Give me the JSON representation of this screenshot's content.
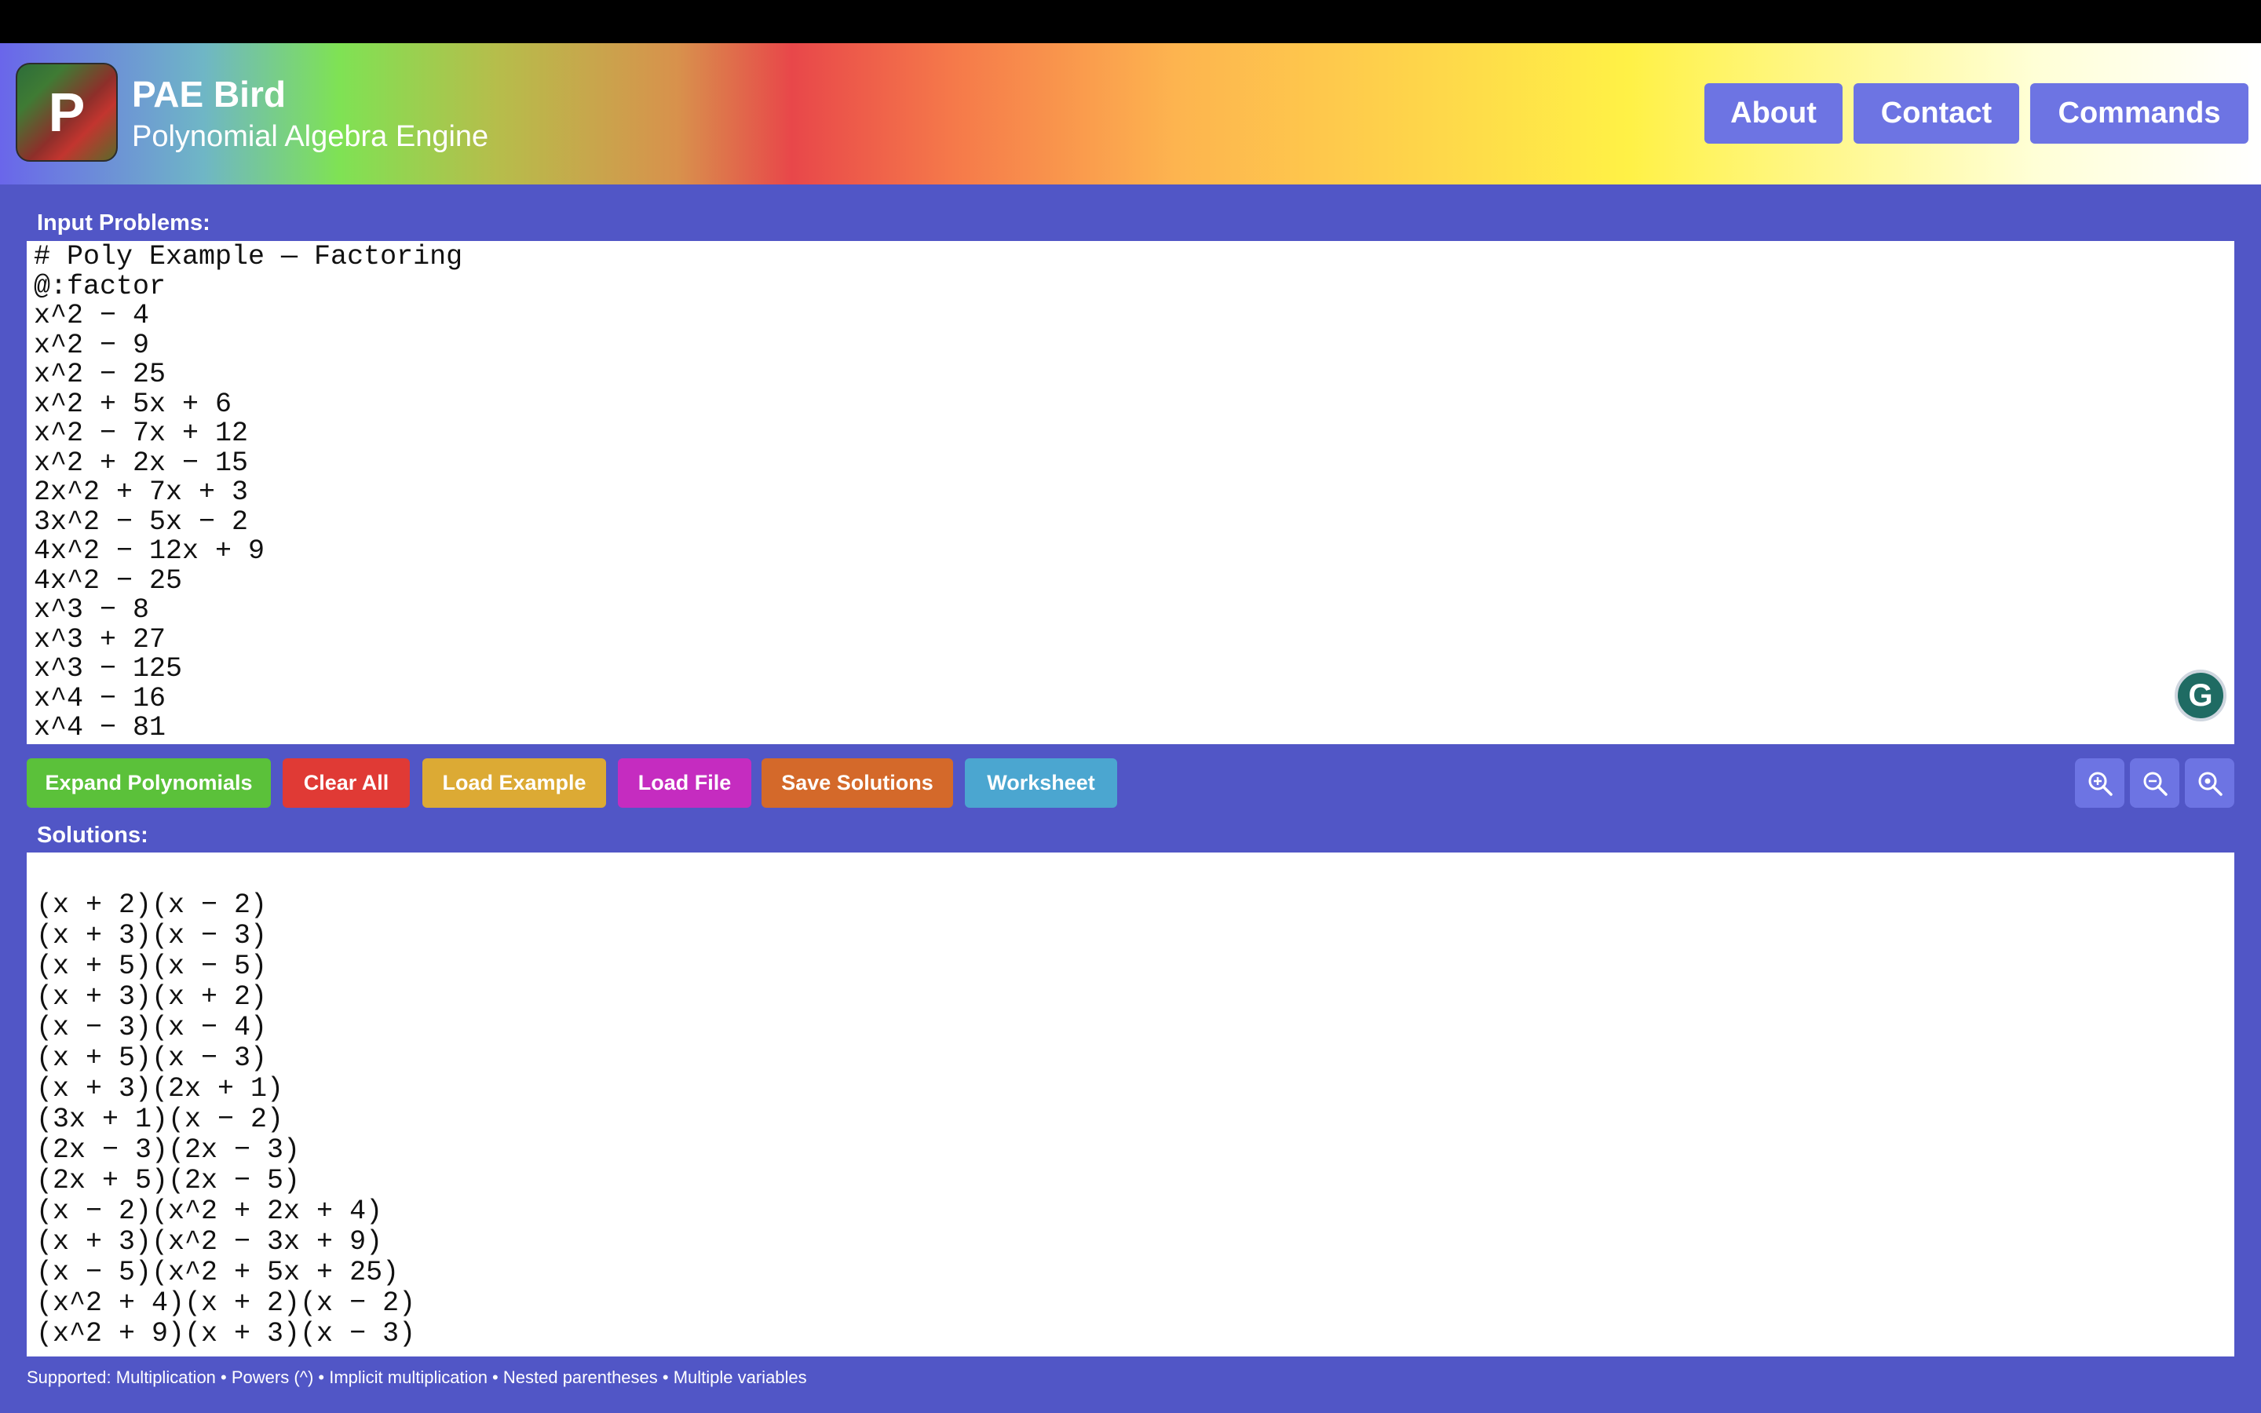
{
  "header": {
    "logo_letter": "P",
    "title": "PAE Bird",
    "subtitle": "Polynomial Algebra Engine",
    "nav": {
      "about": "About",
      "contact": "Contact",
      "commands": "Commands"
    }
  },
  "input": {
    "label": "Input Problems:",
    "lines": [
      "# Poly Example — Factoring",
      "@:factor",
      "x^2 − 4",
      "x^2 − 9",
      "x^2 − 25",
      "x^2 + 5x + 6",
      "x^2 − 7x + 12",
      "x^2 + 2x − 15",
      "2x^2 + 7x + 3",
      "3x^2 − 5x − 2",
      "4x^2 − 12x + 9",
      "4x^2 − 25",
      "x^3 − 8",
      "x^3 + 27",
      "x^3 − 125",
      "x^4 − 16",
      "x^4 − 81"
    ],
    "grammarly_icon": "G"
  },
  "toolbar": {
    "expand": "Expand Polynomials",
    "clear": "Clear All",
    "load_example": "Load Example",
    "load_file": "Load File",
    "save": "Save Solutions",
    "worksheet": "Worksheet",
    "colors": {
      "expand": "#5bc13a",
      "clear": "#e03a35",
      "load_example": "#dcaa34",
      "load_file": "#c52cc0",
      "save": "#d4692a",
      "worksheet": "#4ba6d0"
    }
  },
  "solutions": {
    "label": "Solutions:",
    "lines": [
      "(x + 2)(x − 2)",
      "(x + 3)(x − 3)",
      "(x + 5)(x − 5)",
      "(x + 3)(x + 2)",
      "(x − 3)(x − 4)",
      "(x + 5)(x − 3)",
      "(x + 3)(2x + 1)",
      "(3x + 1)(x − 2)",
      "(2x − 3)(2x − 3)",
      "(2x + 5)(2x − 5)",
      "(x − 2)(x^2 + 2x + 4)",
      "(x + 3)(x^2 − 3x + 9)",
      "(x − 5)(x^2 + 5x + 25)",
      "(x^2 + 4)(x + 2)(x − 2)",
      "(x^2 + 9)(x + 3)(x − 3)"
    ]
  },
  "footer": {
    "text": "Supported: Multiplication • Powers (^) • Implicit multiplication • Nested parentheses • Multiple variables"
  }
}
